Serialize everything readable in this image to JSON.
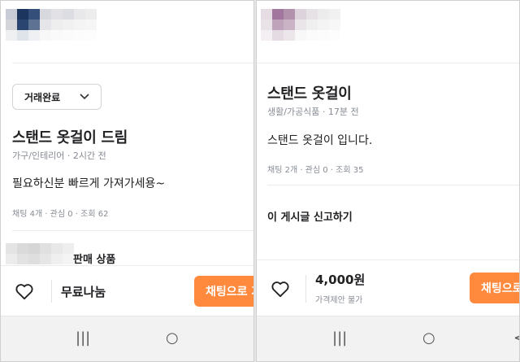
{
  "left": {
    "status_dropdown": "거래완료",
    "title": "스탠드 옷걸이 드림",
    "meta": "가구/인테리어 · 2시간 전",
    "description": "필요하신분 빠르게 가져가세용~",
    "stats": "채팅 4개 · 관심 0 · 조회 62",
    "seller_section_label": "판매 상품",
    "price": "무료나눔",
    "chat_button": "채팅으로 거래하기"
  },
  "right": {
    "title": "스탠드 옷걸이",
    "meta": "생활/가공식품 · 17분 전",
    "description": "스탠드 옷걸이 입니다.",
    "stats": "채팅 2개 · 관심 0 · 조회 35",
    "report_link": "이 게시글 신고하기",
    "price": "4,000원",
    "price_note": "가격제안 불가",
    "chat_button": "채팅으로 거래하기"
  },
  "navbar": {
    "recents": "|||",
    "home": "○",
    "back": "<"
  },
  "colors": {
    "accent": "#ff8a3d",
    "meta_text": "#868b94",
    "divider": "#ececec"
  },
  "icons": [
    "heart-icon",
    "chevron-down-icon",
    "recents-icon",
    "home-icon",
    "back-icon"
  ]
}
